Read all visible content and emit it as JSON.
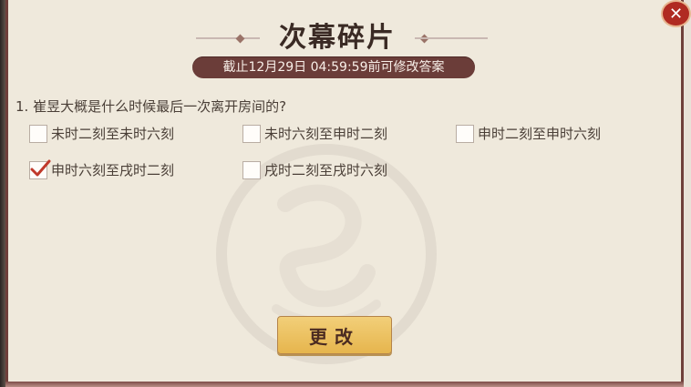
{
  "dialog": {
    "title": "次幕碎片",
    "deadline": "截止12月29日 04:59:59前可修改答案",
    "question": "1. 崔昱大概是什么时候最后一次离开房间的?",
    "options": [
      {
        "label": "未时二刻至未时六刻",
        "checked": false
      },
      {
        "label": "未时六刻至申时二刻",
        "checked": false
      },
      {
        "label": "申时二刻至申时六刻",
        "checked": false
      },
      {
        "label": "申时六刻至戌时二刻",
        "checked": true
      },
      {
        "label": "戌时二刻至戌时六刻",
        "checked": false
      }
    ],
    "submit_label": "更改"
  },
  "colors": {
    "panel": "#efe9dc",
    "border": "#6f3f3a",
    "deadline_bg": "#6b3d39",
    "button": "#e6b54d",
    "check": "#c0392b",
    "close": "#b02b22"
  },
  "icons": {
    "close": "close-icon",
    "emblem": "dragon-emblem-icon",
    "check": "checkmark-icon"
  }
}
